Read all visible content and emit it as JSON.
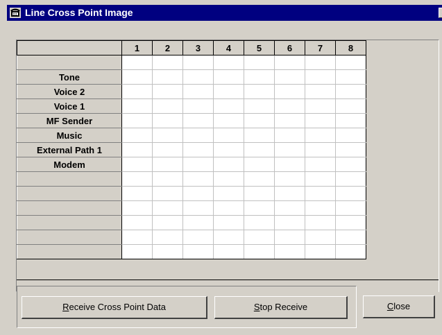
{
  "window": {
    "title": "Line Cross Point Image",
    "icon": "phone-icon",
    "close_glyph": "×"
  },
  "grid": {
    "columns": [
      "1",
      "2",
      "3",
      "4",
      "5",
      "6",
      "7",
      "8"
    ],
    "rows": [
      "",
      "Tone",
      "Voice 2",
      "Voice 1",
      "MF Sender",
      "Music",
      "External Path 1",
      "Modem",
      "",
      "",
      "",
      "",
      "",
      ""
    ]
  },
  "buttons": {
    "receive": {
      "accel": "R",
      "rest": "eceive Cross Point Data"
    },
    "stop": {
      "accel": "S",
      "rest": "top Receive"
    },
    "close": {
      "accel": "C",
      "rest": "lose"
    }
  },
  "colors": {
    "titlebar": "#000080",
    "face": "#d4d0c8",
    "cell": "#ffffff"
  }
}
